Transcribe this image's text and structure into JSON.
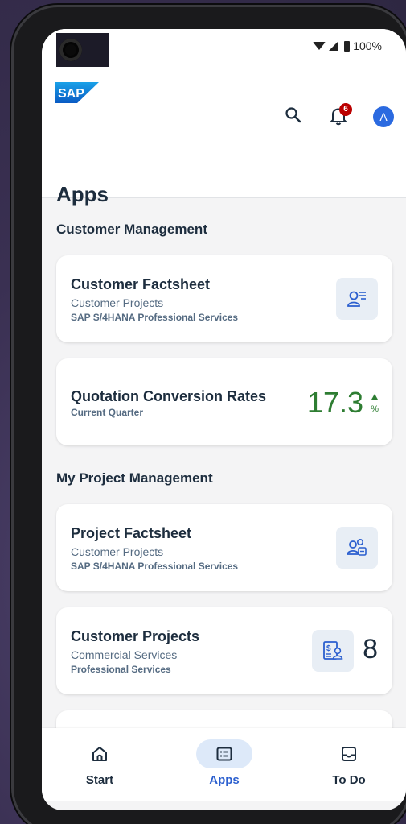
{
  "status": {
    "battery": "100%"
  },
  "header": {
    "logo": "SAP",
    "notifications_count": "6",
    "avatar_initial": "A"
  },
  "page": {
    "title": "Apps"
  },
  "sections": [
    {
      "title": "Customer Management",
      "cards": [
        {
          "title": "Customer Factsheet",
          "subtitle": "Customer Projects",
          "detail": "SAP S/4HANA Professional Services",
          "icon": "customer-factsheet-icon"
        },
        {
          "title": "Quotation Conversion Rates",
          "detail": "Current Quarter",
          "kpi_value": "17.3",
          "kpi_unit": "%",
          "trend": "up",
          "kpi_color": "#2e7d32"
        }
      ]
    },
    {
      "title": "My Project Management",
      "cards": [
        {
          "title": "Project Factsheet",
          "subtitle": "Customer Projects",
          "detail": "SAP S/4HANA Professional Services",
          "icon": "project-factsheet-icon"
        },
        {
          "title": "Customer Projects",
          "subtitle": "Commercial Services",
          "detail": "Professional Services",
          "count": "8",
          "icon": "customer-projects-icon"
        }
      ]
    }
  ],
  "bottom_nav": [
    {
      "label": "Start",
      "icon": "home-icon",
      "active": false
    },
    {
      "label": "Apps",
      "icon": "apps-icon",
      "active": true
    },
    {
      "label": "To Do",
      "icon": "inbox-icon",
      "active": false
    }
  ],
  "colors": {
    "accent": "#2b5fcf",
    "badge": "#bb0000",
    "avatar": "#2b6ae0",
    "kpi_positive": "#2e7d32"
  }
}
